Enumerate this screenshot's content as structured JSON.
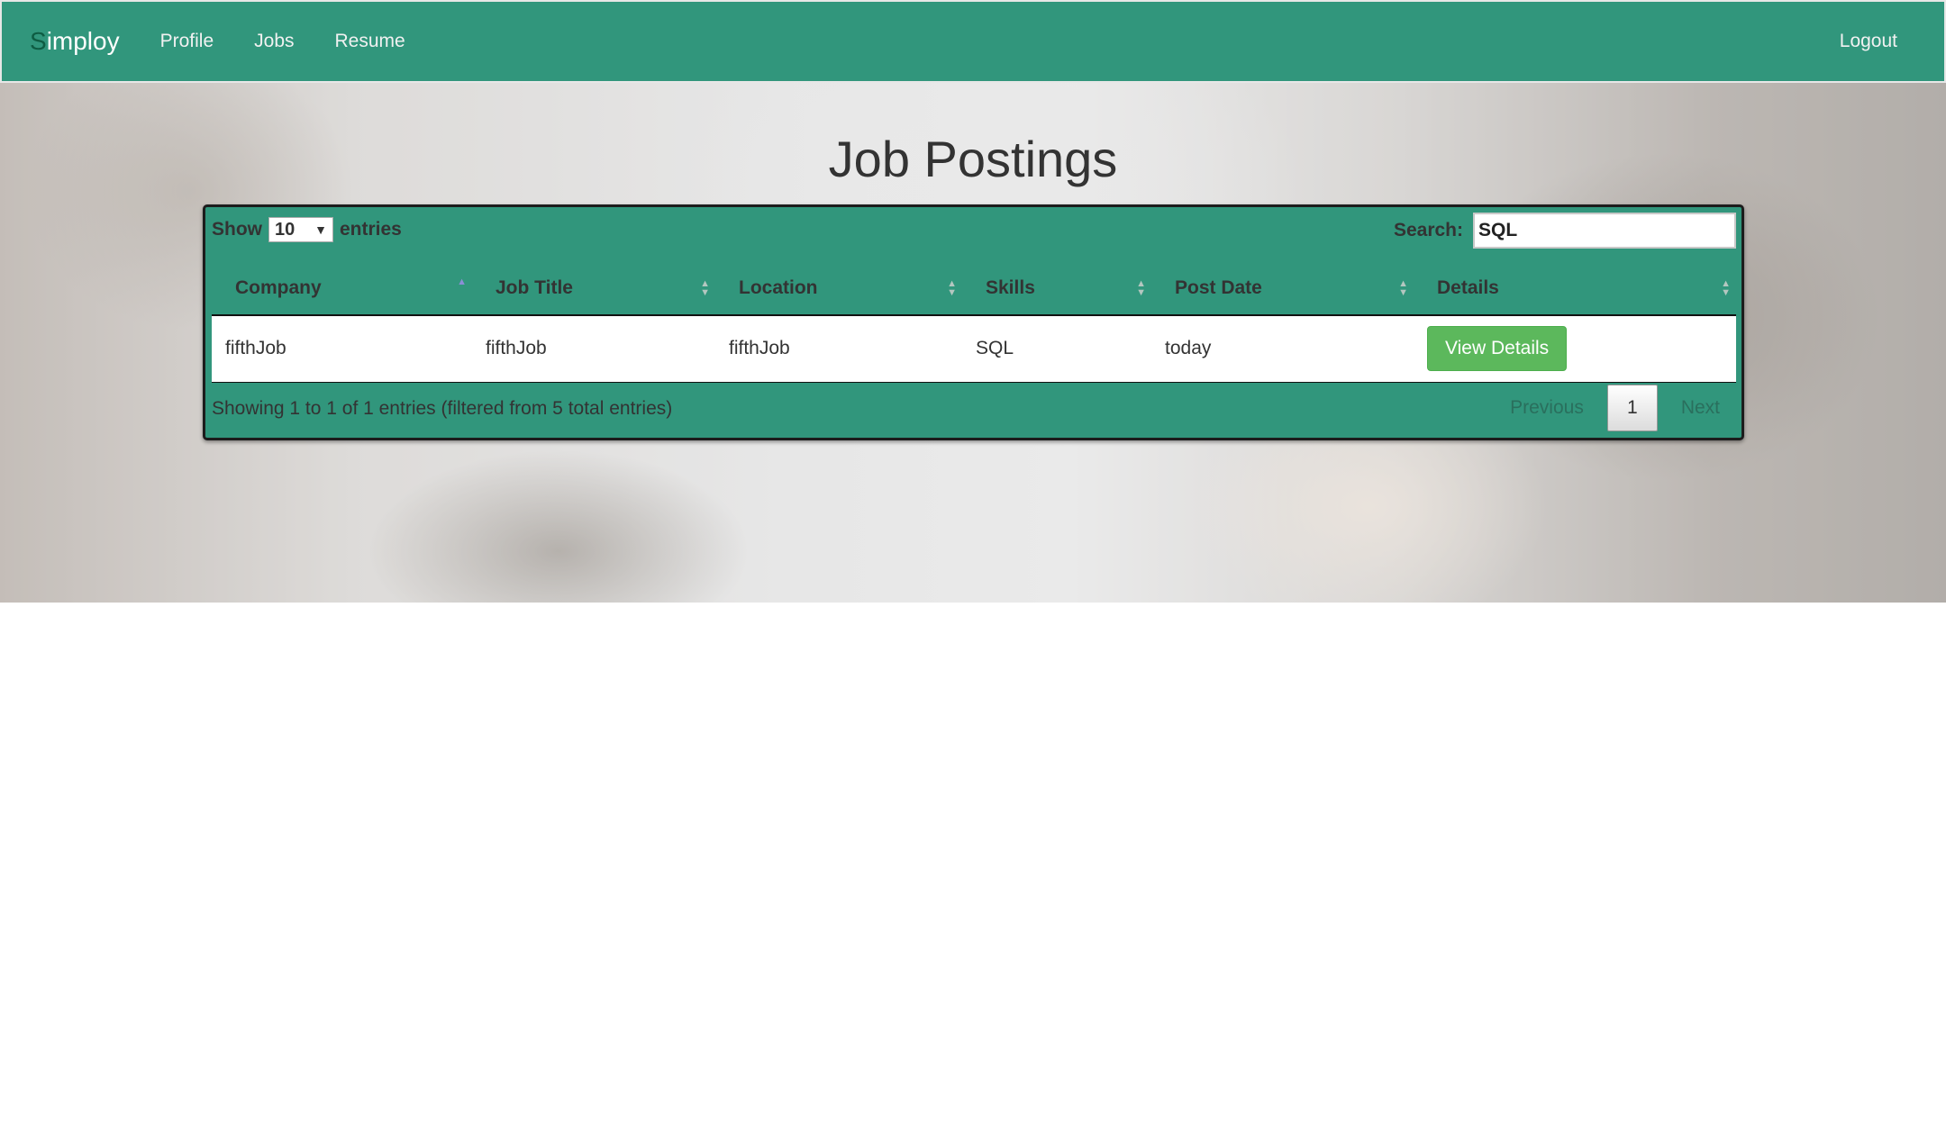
{
  "navbar": {
    "brand_first": "S",
    "brand_rest": "imploy",
    "links": [
      "Profile",
      "Jobs",
      "Resume"
    ],
    "logout": "Logout",
    "color": "#31967c"
  },
  "page": {
    "title": "Job Postings"
  },
  "table": {
    "length": {
      "show_label": "Show",
      "selected": "10",
      "entries_label": "entries"
    },
    "search": {
      "label": "Search:",
      "value": "SQL"
    },
    "columns": [
      "Company",
      "Job Title",
      "Location",
      "Skills",
      "Post Date",
      "Details"
    ],
    "sorted_column": "Company",
    "rows": [
      {
        "company": "fifthJob",
        "job_title": "fifthJob",
        "location": "fifthJob",
        "skills": "SQL",
        "post_date": "today",
        "details_button": "View Details"
      }
    ],
    "info": "Showing 1 to 1 of 1 entries (filtered from 5 total entries)",
    "pagination": {
      "previous": "Previous",
      "current": "1",
      "next": "Next"
    }
  },
  "colors": {
    "accent": "#31967c",
    "button": "#5cb85c"
  }
}
